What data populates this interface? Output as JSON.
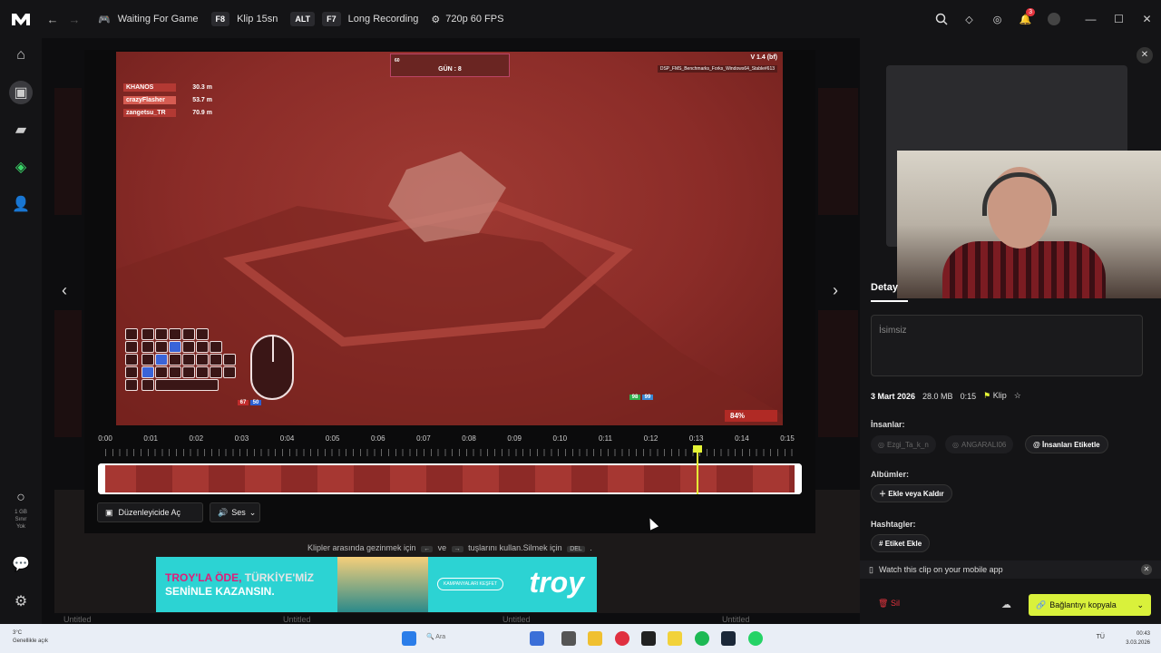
{
  "titlebar": {
    "game_status": "Waiting For Game",
    "clip_key": "F8",
    "clip_label": "Klip 15sn",
    "alt_key": "ALT",
    "rec_key": "F7",
    "rec_label": "Long Recording",
    "quality": "720p 60 FPS",
    "notif_count": "3"
  },
  "sidebar": {
    "storage_value": "1 GB",
    "storage_line1": "Sınır",
    "storage_line2": "Yok"
  },
  "background": {
    "tile_label": "Untitled"
  },
  "video_hud": {
    "players": [
      {
        "name": "KHANOS",
        "dist": "30.3 m"
      },
      {
        "name": "crazyFlasher",
        "dist": "53.7 m"
      },
      {
        "name": "zangetsu_TR",
        "dist": "70.9 m"
      }
    ],
    "top_label": "GÜN : 8",
    "top_number": "60",
    "version": "V 1.4 (bf)",
    "build": "DSP_FMS_Benchmarks_Forks_Windows64_Stable#613",
    "hp_left": "67",
    "hp_right": "50",
    "stat_a": "98",
    "stat_b": "99",
    "percent": "84%"
  },
  "timeline": {
    "ticks": [
      "0:00",
      "0:01",
      "0:02",
      "0:03",
      "0:04",
      "0:05",
      "0:06",
      "0:07",
      "0:08",
      "0:09",
      "0:10",
      "0:11",
      "0:12",
      "0:13",
      "0:14",
      "0:15"
    ],
    "playhead_fraction": 0.867,
    "open_editor": "Düzenleyicide Aç",
    "audio": "Ses"
  },
  "hint": {
    "text_before": "Klipler arasında gezinmek için",
    "text_mid": "ve",
    "text_after": "tuşlarını kullan.Silmek için",
    "key_del": "DEL"
  },
  "ad": {
    "line1_a": "TROY'LA ÖDE,",
    "line1_b": "TÜRKİYE'MİZ",
    "line2": "SENİNLE KAZANSIN.",
    "pill": "KAMPANYALARI KEŞFET",
    "brand": "troy"
  },
  "detail": {
    "tab": "Detay",
    "title_placeholder": "İsimsiz",
    "date": "3 Mart 2026",
    "size": "28.0 MB",
    "duration": "0:15",
    "type": "Klip",
    "people_heading": "İnsanlar:",
    "people": [
      "Ezgi_Ta_k_n",
      "ANGARALI06"
    ],
    "tag_people": "İnsanları Etiketle",
    "albums_heading": "Albümler:",
    "albums_btn": "Ekle veya Kaldır",
    "hashtags_heading": "Hashtagler:",
    "hashtag_btn": "Etiket Ekle",
    "mobile_text": "Watch this clip on your mobile app",
    "delete": "Sil",
    "copy_link": "Bağlantıyı kopyala"
  },
  "taskbar": {
    "weather_temp": "3°C",
    "weather_text": "Genellikle açık",
    "search": "Ara",
    "lang": "TÜ",
    "time": "00:43",
    "date": "3.03.2026"
  }
}
